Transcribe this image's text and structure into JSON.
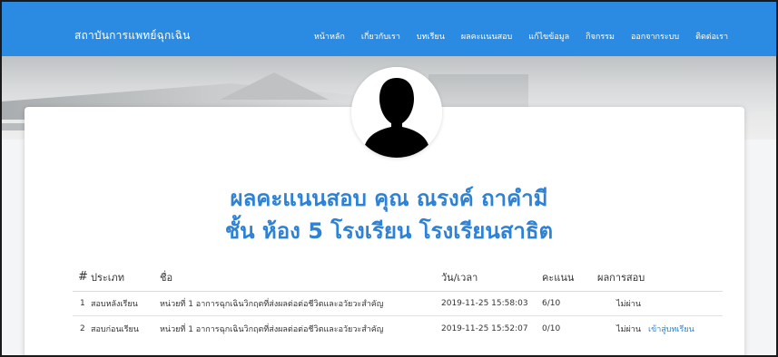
{
  "navbar": {
    "brand": "สถาบันการแพทย์ฉุกเฉิน",
    "links": [
      "หน้าหลัก",
      "เกี่ยวกับเรา",
      "บทเรียน",
      "ผลคะแนนสอบ",
      "แก้ไขข้อมูล",
      "กิจกรรม",
      "ออกจากระบบ",
      "ติดต่อเรา"
    ]
  },
  "page": {
    "title_line1": "ผลคะแนนสอบ คุณ ณรงค์ ถาคำมี",
    "title_line2": "ชั้น ห้อง 5 โรงเรียน โรงเรียนสาธิต"
  },
  "table": {
    "headers": {
      "no": "#",
      "type": "ประเภท",
      "name": "ชื่อ",
      "date": "วัน/เวลา",
      "score": "คะแนน",
      "result": "ผลการสอบ"
    },
    "rows": [
      {
        "no": "1",
        "type": "สอบหลังเรียน",
        "name": "หน่วยที่ 1 อาการฉุกเฉินวิกฤตที่ส่งผลต่อต่อชีวิตและอวัยวะสำคัญ",
        "date": "2019-11-25 15:58:03",
        "score": "6/10",
        "result": "ไม่ผ่าน",
        "action": ""
      },
      {
        "no": "2",
        "type": "สอบก่อนเรียน",
        "name": "หน่วยที่ 1 อาการฉุกเฉินวิกฤตที่ส่งผลต่อต่อชีวิตและอวัยวะสำคัญ",
        "date": "2019-11-25 15:52:07",
        "score": "0/10",
        "result": "ไม่ผ่าน",
        "action": "เข้าสู่บทเรียน"
      }
    ]
  },
  "colors": {
    "navbar": "#2b8be3",
    "title": "#2e82d6",
    "link": "#2e82d6"
  },
  "icons": {
    "avatar": "user-silhouette-icon"
  }
}
